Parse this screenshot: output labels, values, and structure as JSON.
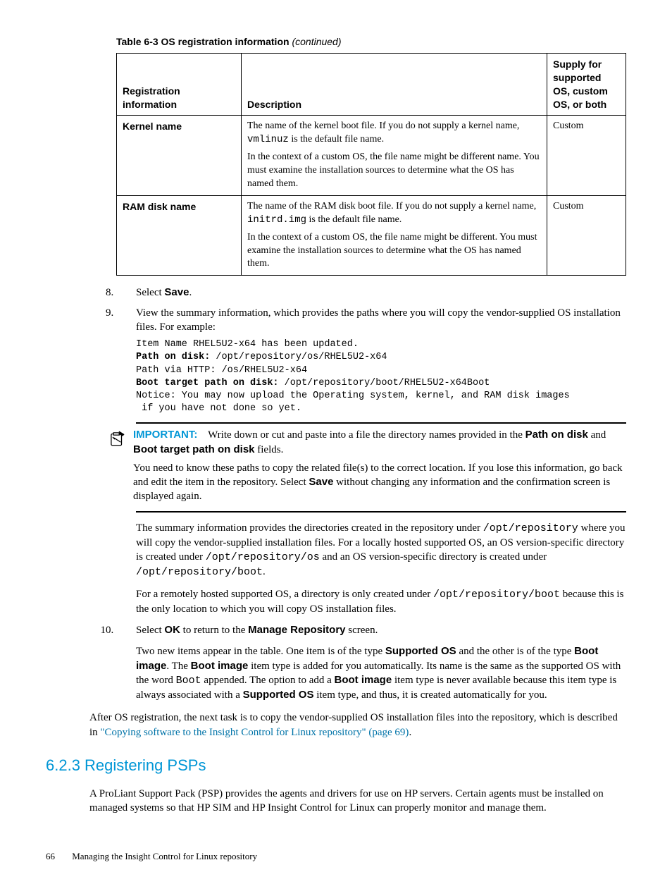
{
  "table": {
    "caption_prefix": "Table 6-3 OS registration information",
    "caption_suffix": "(continued)",
    "headers": {
      "col1": "Registration information",
      "col2": "Description",
      "col3": "Supply for supported OS, custom OS, or both"
    },
    "rows": [
      {
        "label": "Kernel name",
        "desc_p1_a": "The name of the kernel boot file. If you do not supply a kernel name, ",
        "desc_p1_code": "vmlinuz",
        "desc_p1_b": " is the default file name.",
        "desc_p2": "In the context of a custom OS, the file name might be different name. You must examine the installation sources to determine what the OS has named them.",
        "supply": "Custom"
      },
      {
        "label": "RAM disk name",
        "desc_p1_a": "The name of the RAM disk boot file. If you do not supply a kernel name, ",
        "desc_p1_code": "initrd.img",
        "desc_p1_b": " is the default file name.",
        "desc_p2": "In the context of a custom OS, the file name might be different. You must examine the installation sources to determine what the OS has named them.",
        "supply": "Custom"
      }
    ]
  },
  "steps": {
    "s8_a": "Select ",
    "s8_b": "Save",
    "s8_c": ".",
    "s9": "View the summary information, which provides the paths where you will copy the vendor-supplied OS installation files. For example:",
    "code": {
      "l1": "Item Name RHEL5U2-x64 has been updated.",
      "l2a": "Path on disk:",
      "l2b": " /opt/repository/os/RHEL5U2-x64",
      "l3": "Path via HTTP: /os/RHEL5U2-x64",
      "l4a": "Boot target path on disk:",
      "l4b": " /opt/repository/boot/RHEL5U2-x64Boot",
      "l5": "Notice: You may now upload the Operating system, kernel, and RAM disk images",
      "l6": " if you have not done so yet."
    },
    "note": {
      "label": "IMPORTANT:",
      "p1_a": "Write down or cut and paste into a file the directory names provided in the ",
      "p1_b": "Path on disk",
      "p1_c": " and ",
      "p1_d": "Boot target path on disk",
      "p1_e": " fields.",
      "p2_a": "You need to know these paths to copy the related file(s) to the correct location. If you lose this information, go back and edit the item in the repository. Select ",
      "p2_b": "Save",
      "p2_c": " without changing any information and the confirmation screen is displayed again."
    },
    "para1_a": "The summary information provides the directories created in the repository under ",
    "para1_c1": "/opt/repository",
    "para1_b": " where you will copy the vendor-supplied installation files. For a locally hosted supported OS, an OS version-specific directory is created under ",
    "para1_c2": "/opt/repository/os",
    "para1_c": " and an OS version-specific directory is created under ",
    "para1_c3": "/opt/repository/boot",
    "para1_d": ".",
    "para2_a": "For a remotely hosted supported OS, a directory is only created under ",
    "para2_c1": "/opt/repository/boot",
    "para2_b": " because this is the only location to which you will copy OS installation files.",
    "s10_a": "Select ",
    "s10_b": "OK",
    "s10_c": " to return to the ",
    "s10_d": "Manage Repository",
    "s10_e": " screen.",
    "s10p_a": "Two new items appear in the table. One item is of the type ",
    "s10p_b": "Supported OS",
    "s10p_c": " and the other is of the type ",
    "s10p_d": "Boot image",
    "s10p_e": ". The ",
    "s10p_f": "Boot image",
    "s10p_g": " item type is added for you automatically. Its name is the same as the supported OS with the word ",
    "s10p_code": "Boot",
    "s10p_h": " appended. The option to add a ",
    "s10p_i": "Boot image",
    "s10p_j": " item type is never available because this item type is always associated with a ",
    "s10p_k": "Supported OS",
    "s10p_l": " item type, and thus, it is created automatically for you."
  },
  "after": {
    "a": "After OS registration, the next task is to copy the vendor-supplied OS installation files into the repository, which is described in ",
    "link": "\"Copying software to the Insight Control for Linux repository\" (page 69)",
    "b": "."
  },
  "section": {
    "heading": "6.2.3 Registering PSPs",
    "body": "A ProLiant Support Pack (PSP) provides the agents and drivers for use on HP servers. Certain agents must be installed on managed systems so that HP SIM and HP Insight Control for Linux can properly monitor and manage them."
  },
  "footer": {
    "page": "66",
    "title": "Managing the Insight Control for Linux repository"
  }
}
